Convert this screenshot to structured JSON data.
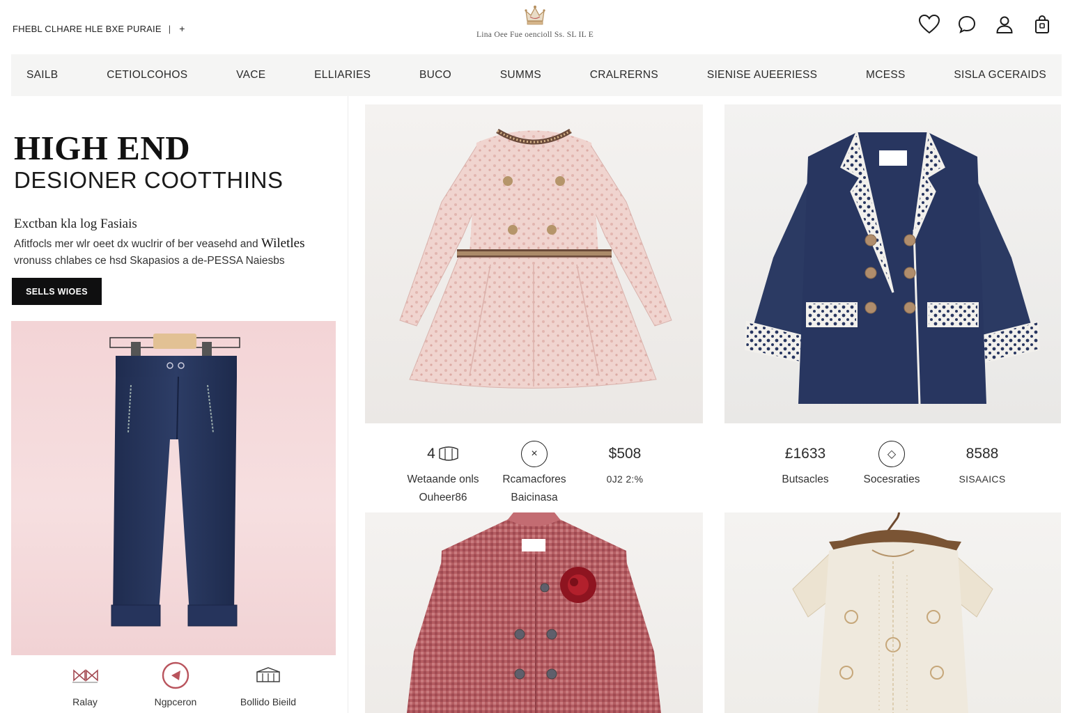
{
  "header": {
    "promo_text": "FHEBL CLHARE HLE BXE PURAIE",
    "promo_separator": "|",
    "promo_plus": "+",
    "logo_tagline": "Lina Oee Fue oencioll Ss. SL IL E",
    "icons": [
      "heart-icon",
      "chat-icon",
      "user-icon",
      "bag-icon"
    ]
  },
  "nav": {
    "items": [
      "SAILB",
      "CETIOLCOHOS",
      "VACE",
      "ELLIARIES",
      "BUCO",
      "SUMMS",
      "CRALRERNS",
      "SIENISE AUEERIESS",
      "MCESS",
      "SISLA GCERAIDS"
    ]
  },
  "hero": {
    "title": "HIGH END",
    "subtitle": "DESIONER COOTTHINS",
    "lead": "Exctban kla log  Fasiais",
    "body_line1_start": "Afitfocls mer wlr oeet dx wuclrir of ber veasehd and ",
    "body_line1_emph": "Wiletles",
    "body_line2": "vronuss chlabes ce hsd  Skapasios  a de-PESSA Naiesbs",
    "cta_label": "SELLS WIOES"
  },
  "left_features": [
    {
      "icon": "bows-icon",
      "label": "Ralay"
    },
    {
      "icon": "circle-play-icon",
      "label": "Ngpceron"
    },
    {
      "icon": "building-icon",
      "label": "Bollido Bieild"
    }
  ],
  "stats_left": [
    {
      "value": "4",
      "icon": "tag-icon",
      "label_line1": "Wetaande onls",
      "label_line2": "Ouheer86"
    },
    {
      "icon": "close-icon",
      "symbol": "×",
      "label_line1": "Rcamacfores",
      "label_line2": "Baicinasa"
    },
    {
      "value": "$508",
      "label_line1": "0J2 2:%"
    }
  ],
  "stats_right": [
    {
      "value": "£1633",
      "label_line1": "Butsacles"
    },
    {
      "icon": "diamond-icon",
      "symbol": "◇",
      "label_line1": "Socesraties"
    },
    {
      "value": "8588",
      "label_line1": "SISAAICS"
    }
  ],
  "colors": {
    "accent_dark": "#0f0f10",
    "hero_pink": "#f3d4d6",
    "navy": "#27365c",
    "rose": "#b9545d",
    "nav_bg": "#f5f5f4"
  }
}
